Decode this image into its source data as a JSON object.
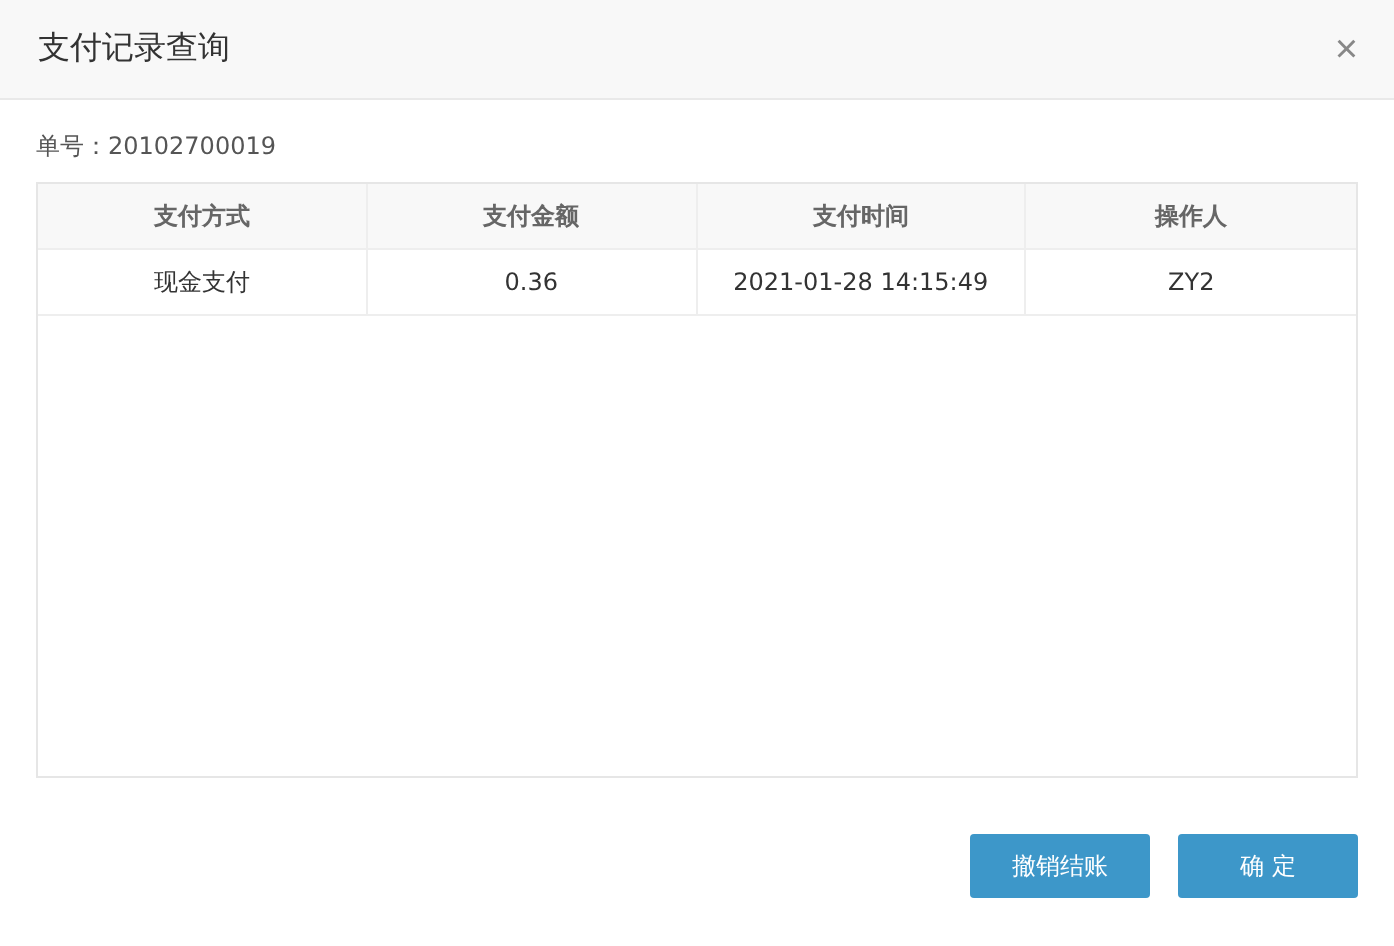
{
  "window": {
    "title": "支付记录查询",
    "close": "×"
  },
  "order_label": "单号：20102700019",
  "table": {
    "columns": [
      "支付方式",
      "支付金额",
      "支付时间",
      "操作人"
    ],
    "rows": [
      [
        "现金支付",
        "0.36",
        "2021-01-28 14:15:49",
        "ZY2"
      ]
    ]
  },
  "buttons": [
    "撤销结账",
    "确 定"
  ]
}
